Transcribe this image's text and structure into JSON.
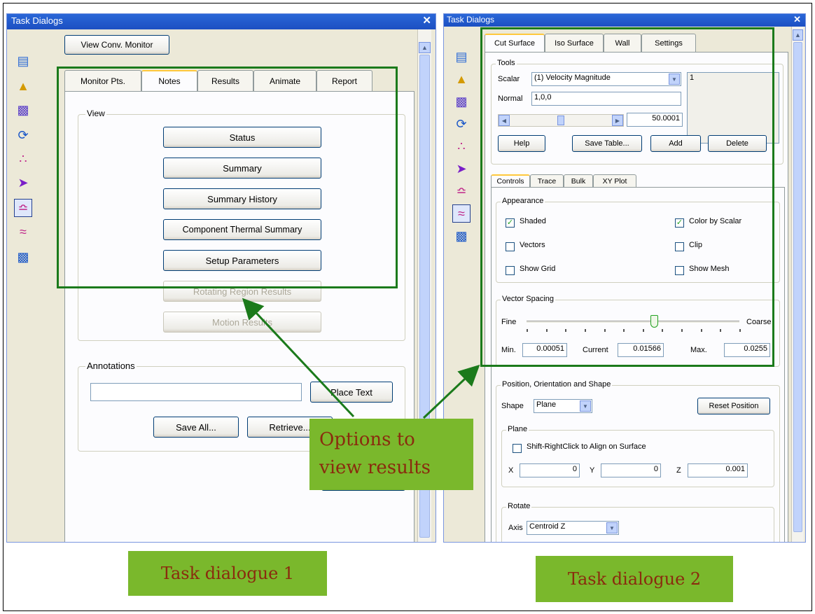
{
  "dialog1": {
    "title": "Task Dialogs",
    "close": "✕",
    "view_monitor_button": "View Conv. Monitor",
    "tabs": [
      "Monitor Pts.",
      "Notes",
      "Results",
      "Animate",
      "Report"
    ],
    "view_group": "View",
    "buttons": [
      {
        "label": "Status",
        "enabled": true
      },
      {
        "label": "Summary",
        "enabled": true
      },
      {
        "label": "Summary History",
        "enabled": true
      },
      {
        "label": "Component Thermal Summary",
        "enabled": true
      },
      {
        "label": "Setup Parameters",
        "enabled": true
      },
      {
        "label": "Rotating Region Results",
        "enabled": false
      },
      {
        "label": "Motion Results",
        "enabled": false
      }
    ],
    "annotations_group": "Annotations",
    "annotation_value": "",
    "place_text": "Place Text",
    "save_all": "Save All...",
    "retrieve": "Retrieve..."
  },
  "dialog2": {
    "title": "Task Dialogs",
    "close": "✕",
    "tabs": [
      "Cut Surface",
      "Iso Surface",
      "Wall",
      "Settings"
    ],
    "tools": {
      "group": "Tools",
      "scalar_label": "Scalar",
      "scalar_value": "(1) Velocity Magnitude",
      "list_value": "1",
      "normal_label": "Normal",
      "normal_value": "1,0,0",
      "position_value": "50.0001",
      "help": "Help",
      "save_table": "Save Table...",
      "add": "Add",
      "delete": "Delete"
    },
    "subtabs": [
      "Controls",
      "Trace",
      "Bulk",
      "XY Plot"
    ],
    "appearance": {
      "group": "Appearance",
      "shaded": {
        "label": "Shaded",
        "checked": true
      },
      "color_by_scalar": {
        "label": "Color by Scalar",
        "checked": true
      },
      "vectors": {
        "label": "Vectors",
        "checked": false
      },
      "clip": {
        "label": "Clip",
        "checked": false
      },
      "show_grid": {
        "label": "Show Grid",
        "checked": false
      },
      "show_mesh": {
        "label": "Show Mesh",
        "checked": false
      }
    },
    "vector_spacing": {
      "group": "Vector Spacing",
      "fine": "Fine",
      "coarse": "Coarse",
      "min_label": "Min.",
      "min_value": "0.00051",
      "current_label": "Current",
      "current_value": "0.01566",
      "max_label": "Max.",
      "max_value": "0.0255",
      "slider_fraction": 0.6
    },
    "position": {
      "group": "Position, Orientation and Shape",
      "shape_label": "Shape",
      "shape_value": "Plane",
      "reset": "Reset Position",
      "plane_group": "Plane",
      "shift_label": "Shift-RightClick to Align on Surface",
      "shift_checked": false,
      "x_label": "X",
      "x_value": "0",
      "y_label": "Y",
      "y_value": "0",
      "z_label": "Z",
      "z_value": "0.001",
      "rotate_group": "Rotate",
      "axis_label": "Axis",
      "axis_value": "Centroid Z"
    }
  },
  "callout": {
    "line1": "Options to",
    "line2": "view results"
  },
  "caption1": "Task dialogue 1",
  "caption2": "Task dialogue 2",
  "colors": {
    "highlight": "#1b7a1b",
    "callout_bg": "#7ab82c",
    "callout_text": "#8a2b0e",
    "titlebar": "#1f58cc"
  }
}
